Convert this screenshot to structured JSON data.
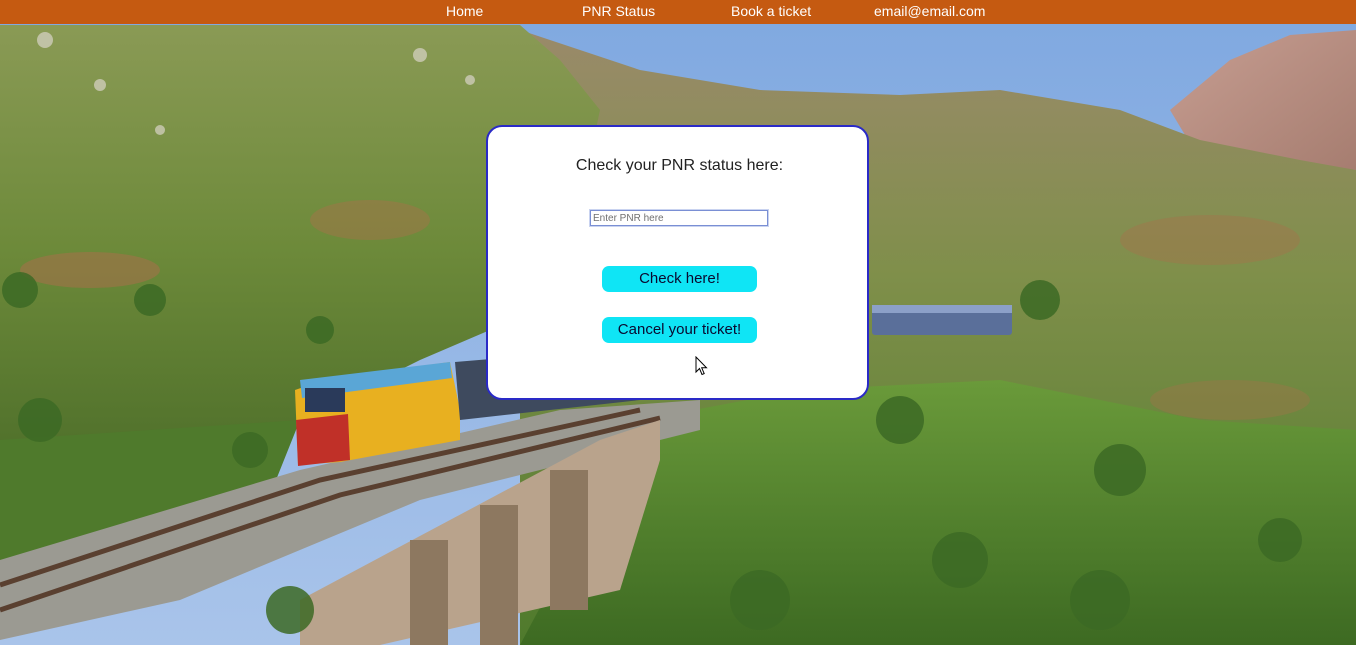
{
  "navbar": {
    "background": "#c55a11",
    "items": [
      {
        "label": "Home"
      },
      {
        "label": "PNR Status"
      },
      {
        "label": "Book a ticket"
      },
      {
        "label": "email@email.com"
      }
    ]
  },
  "pnr_card": {
    "title": "Check your PNR status here:",
    "input_placeholder": "Enter PNR here",
    "input_value": "",
    "check_button_label": "Check here!",
    "cancel_button_label": "Cancel your ticket!",
    "button_color": "#0fe5f5",
    "border_color": "#2a2ac7"
  },
  "background_image": {
    "subject": "train-on-bridge-in-hills"
  }
}
